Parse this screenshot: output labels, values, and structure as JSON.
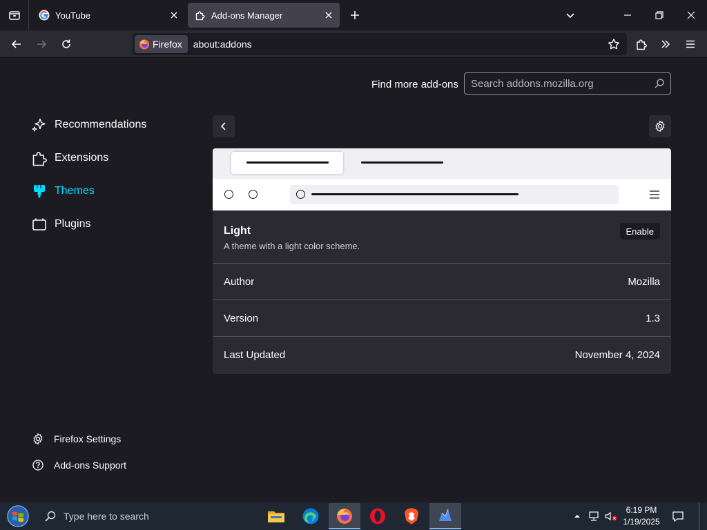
{
  "browser": {
    "tabs": [
      {
        "title": "YouTube",
        "active": false
      },
      {
        "title": "Add-ons Manager",
        "active": true
      }
    ],
    "identity_label": "Firefox",
    "url": "about:addons"
  },
  "addons": {
    "find_more_label": "Find more add-ons",
    "search_placeholder": "Search addons.mozilla.org",
    "categories": [
      {
        "label": "Recommendations",
        "icon": "sparkle-icon",
        "active": false
      },
      {
        "label": "Extensions",
        "icon": "puzzle-icon",
        "active": false
      },
      {
        "label": "Themes",
        "icon": "brush-icon",
        "active": true
      },
      {
        "label": "Plugins",
        "icon": "plugin-icon",
        "active": false
      }
    ],
    "footer_links": [
      {
        "label": "Firefox Settings",
        "icon": "gear-icon"
      },
      {
        "label": "Add-ons Support",
        "icon": "help-icon"
      }
    ],
    "theme": {
      "name": "Light",
      "description": "A theme with a light color scheme.",
      "enable_label": "Enable",
      "details": [
        {
          "label": "Author",
          "value": "Mozilla"
        },
        {
          "label": "Version",
          "value": "1.3"
        },
        {
          "label": "Last Updated",
          "value": "November 4, 2024"
        }
      ]
    }
  },
  "taskbar": {
    "search_placeholder": "Type here to search",
    "time": "6:19 PM",
    "date": "1/19/2025",
    "apps": [
      "file-explorer-icon",
      "edge-icon",
      "firefox-icon",
      "opera-icon",
      "brave-icon",
      "app-icon"
    ]
  },
  "colors": {
    "accent": "#00ddff",
    "page_bg": "#1c1b22",
    "card_bg": "#2b2a33"
  }
}
